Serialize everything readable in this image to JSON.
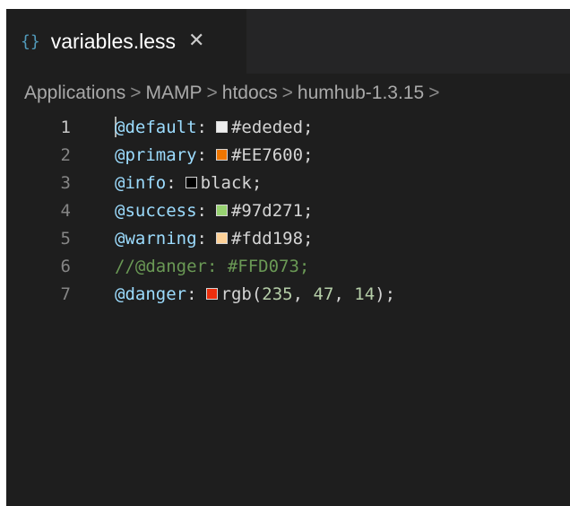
{
  "tab": {
    "icon_glyph": "{}",
    "icon_name": "braces-icon",
    "title": "variables.less",
    "close_glyph": "✕"
  },
  "breadcrumb": [
    "Applications",
    "MAMP",
    "htdocs",
    "humhub-1.3.15"
  ],
  "breadcrumb_separator": ">",
  "lines": [
    {
      "num": "1",
      "name": "@default",
      "colon": ":",
      "value": "#ededed",
      "semi": ";",
      "swatch": "#ededed",
      "type": "decl"
    },
    {
      "num": "2",
      "name": "@primary",
      "colon": ":",
      "value": "#EE7600",
      "semi": ";",
      "swatch": "#EE7600",
      "type": "decl"
    },
    {
      "num": "3",
      "name": "@info",
      "colon": ":",
      "value": "black",
      "semi": ";",
      "swatch": "#000000",
      "type": "decl"
    },
    {
      "num": "4",
      "name": "@success",
      "colon": ":",
      "value": "#97d271",
      "semi": ";",
      "swatch": "#97d271",
      "type": "decl"
    },
    {
      "num": "5",
      "name": "@warning",
      "colon": ":",
      "value": "#fdd198",
      "semi": ";",
      "swatch": "#fdd198",
      "type": "decl"
    },
    {
      "num": "6",
      "comment": "//@danger: #FFD073;",
      "type": "comment"
    },
    {
      "num": "7",
      "name": "@danger",
      "colon": ":",
      "rgb_fn": "rgb(",
      "rgb_values": [
        "235",
        "47",
        "14"
      ],
      "rgb_close": ")",
      "semi": ";",
      "swatch": "#eb2f0e",
      "type": "rgb"
    }
  ]
}
